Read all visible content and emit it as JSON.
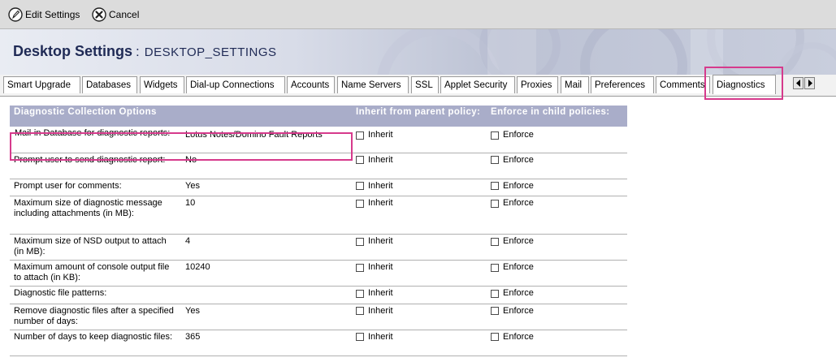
{
  "toolbar": {
    "edit_label": "Edit Settings",
    "cancel_label": "Cancel"
  },
  "header": {
    "title": "Desktop Settings",
    "separator": ":",
    "subtitle": "DESKTOP_SETTINGS"
  },
  "tabs": [
    {
      "label": "Smart Upgrade"
    },
    {
      "label": "Databases"
    },
    {
      "label": "Widgets"
    },
    {
      "label": "Dial-up Connections"
    },
    {
      "label": "Accounts"
    },
    {
      "label": "Name Servers"
    },
    {
      "label": "SSL"
    },
    {
      "label": "Applet Security"
    },
    {
      "label": "Proxies"
    },
    {
      "label": "Mail"
    },
    {
      "label": "Preferences"
    },
    {
      "label": "Comments"
    },
    {
      "label": "Diagnostics",
      "active": true
    }
  ],
  "section": {
    "headers": {
      "options": "Diagnostic Collection Options",
      "inherit": "Inherit from parent policy:",
      "enforce": "Enforce in child policies:"
    },
    "rows": [
      {
        "label": "Mail-in Database for diagnostic reports:",
        "value": "Lotus Notes/Domino Fault Reports",
        "inherit": "Inherit",
        "enforce": "Enforce"
      },
      {
        "label": "Prompt user to send diagnostic report:",
        "value": "No",
        "inherit": "Inherit",
        "enforce": "Enforce"
      },
      {
        "label": "Prompt user for comments:",
        "value": "Yes",
        "inherit": "Inherit",
        "enforce": "Enforce"
      },
      {
        "label": "Maximum size of diagnostic message including attachments (in MB):",
        "value": "10",
        "inherit": "Inherit",
        "enforce": "Enforce"
      },
      {
        "label": "Maximum size of NSD output to attach (in MB):",
        "value": "4",
        "inherit": "Inherit",
        "enforce": "Enforce"
      },
      {
        "label": "Maximum amount of console output file to attach (in KB):",
        "value": "10240",
        "inherit": "Inherit",
        "enforce": "Enforce"
      },
      {
        "label": "Diagnostic file patterns:",
        "value": "",
        "inherit": "Inherit",
        "enforce": "Enforce"
      },
      {
        "label": "Remove diagnostic files after a specified number of days:",
        "value": "Yes",
        "inherit": "Inherit",
        "enforce": "Enforce"
      },
      {
        "label": "Number of days to keep diagnostic files:",
        "value": "365",
        "inherit": "Inherit",
        "enforce": "Enforce"
      }
    ]
  },
  "colors": {
    "highlight": "#d63a8c",
    "header_band": "#a9adc9",
    "title_text": "#1f2a55"
  }
}
